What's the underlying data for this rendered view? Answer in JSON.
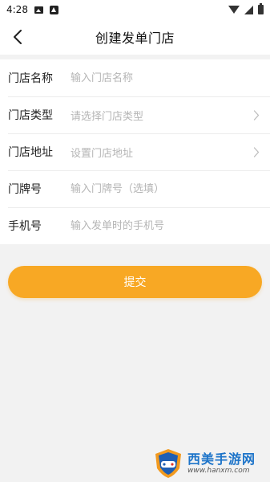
{
  "status_bar": {
    "time": "4:28",
    "icons": [
      "image-icon",
      "warning-icon",
      "wifi-icon",
      "signal-icon",
      "battery-icon"
    ]
  },
  "nav": {
    "title": "创建发单门店",
    "back_icon": "chevron-left-icon"
  },
  "form": {
    "rows": [
      {
        "label": "门店名称",
        "placeholder": "输入门店名称",
        "type": "input"
      },
      {
        "label": "门店类型",
        "placeholder": "请选择门店类型",
        "type": "select"
      },
      {
        "label": "门店地址",
        "placeholder": "设置门店地址",
        "type": "select"
      },
      {
        "label": "门牌号",
        "placeholder": "输入门牌号（选填）",
        "type": "input"
      },
      {
        "label": "手机号",
        "placeholder": "输入发单时的手机号",
        "type": "input"
      }
    ]
  },
  "submit": {
    "label": "提交",
    "color": "#f8a824"
  },
  "watermark": {
    "title": "西美手游网",
    "url": "www.hanxm.com"
  },
  "colors": {
    "accent": "#f8a824",
    "background": "#f2f2f2",
    "placeholder": "#b5b5b5"
  }
}
